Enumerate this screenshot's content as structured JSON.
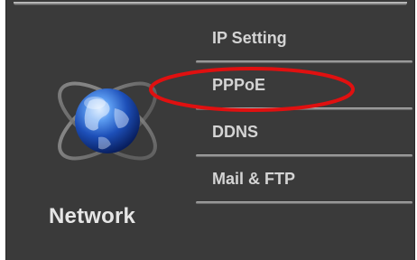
{
  "section": {
    "title": "Network"
  },
  "menu": {
    "items": [
      {
        "label": "IP Setting"
      },
      {
        "label": "PPPoE"
      },
      {
        "label": "DDNS"
      },
      {
        "label": "Mail & FTP"
      }
    ]
  },
  "colors": {
    "panel_bg": "#3a3a3a",
    "menu_text": "#d4d4d4",
    "title_text": "#e6e6e6",
    "highlight_ring": "#e01010",
    "globe_blue": "#2a6fd1"
  },
  "icons": {
    "section_icon": "globe-orbit-icon"
  }
}
